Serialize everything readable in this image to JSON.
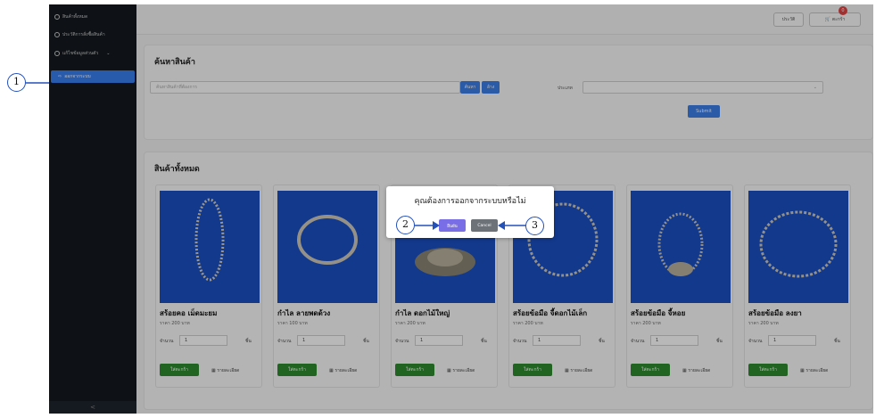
{
  "sidebar": {
    "items": [
      {
        "label": "สินค้าทั้งหมด"
      },
      {
        "label": "ประวัติการสั่งซื้อสินค้า"
      },
      {
        "label": "แก้ไขข้อมูลส่วนตัว"
      }
    ],
    "active_item": "ออกจากระบบ",
    "collapse": "<"
  },
  "header": {
    "history_label": "ประวัติ",
    "cart_label": "ตะกร้า",
    "cart_count": "0"
  },
  "search": {
    "title": "ค้นหาสินค้า",
    "placeholder": "ค้นหาสินค้าที่ต้องการ",
    "search_button": "ค้นหา",
    "clear_button": "ล้าง",
    "type_label": "ประเภท",
    "submit_button": "Submit"
  },
  "products": {
    "title": "สินค้าทั้งหมด",
    "qty_label": "จำนวน",
    "unit_label": "ชิ้น",
    "cart_button": "ใส่ตะกร้า",
    "detail_label": "รายละเอียด",
    "items": [
      {
        "name": "สร้อยคอ เม็ดมะยม",
        "price": "ราคา 200 บาท",
        "qty": "1"
      },
      {
        "name": "กำไล ลายพดด้วง",
        "price": "ราคา 100 บาท",
        "qty": "1"
      },
      {
        "name": "กำไล ดอกไม้ใหญ่",
        "price": "ราคา 200 บาท",
        "qty": "1"
      },
      {
        "name": "สร้อยข้อมือ จี้ดอกไม้เล็ก",
        "price": "ราคา 200 บาท",
        "qty": "1"
      },
      {
        "name": "สร้อยข้อมือ จี้หอย",
        "price": "ราคา 200 บาท",
        "qty": "1"
      },
      {
        "name": "สร้อยข้อมือ ลงยา",
        "price": "ราคา 200 บาท",
        "qty": "1"
      }
    ]
  },
  "dialog": {
    "question": "คุณต้องการออกจากระบบหรือไม่",
    "confirm": "ยืนยัน",
    "cancel": "Cancel"
  },
  "markers": [
    "1",
    "2",
    "3"
  ],
  "colors": {
    "sidebar": "#14191f",
    "accent": "#3c7ee8",
    "cart_green": "#2f8a2f",
    "confirm_purple": "#7a6ee6"
  }
}
